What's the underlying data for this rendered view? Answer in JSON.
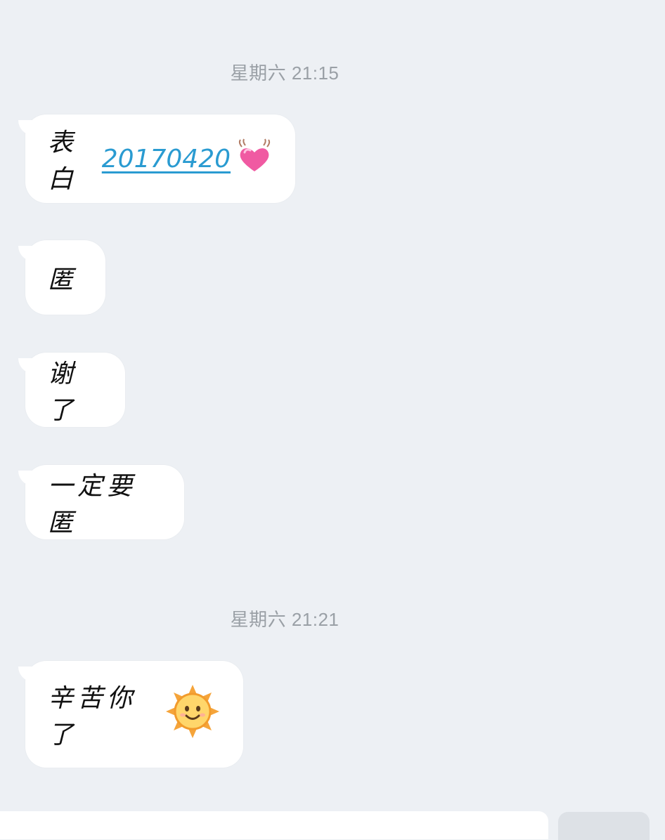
{
  "timestamps": [
    "星期六 21:15",
    "星期六 21:21"
  ],
  "messages": [
    {
      "text": "表白",
      "link": "20170420",
      "emoji": "heart-icon"
    },
    {
      "text": "匿"
    },
    {
      "text": "谢了"
    },
    {
      "text": "一定要匿"
    },
    {
      "text": "辛苦你了",
      "emoji": "sun-icon"
    }
  ],
  "colors": {
    "background": "#edf0f4",
    "bubble": "#ffffff",
    "link": "#2a9bd1",
    "timestamp": "#9aa0a6"
  }
}
